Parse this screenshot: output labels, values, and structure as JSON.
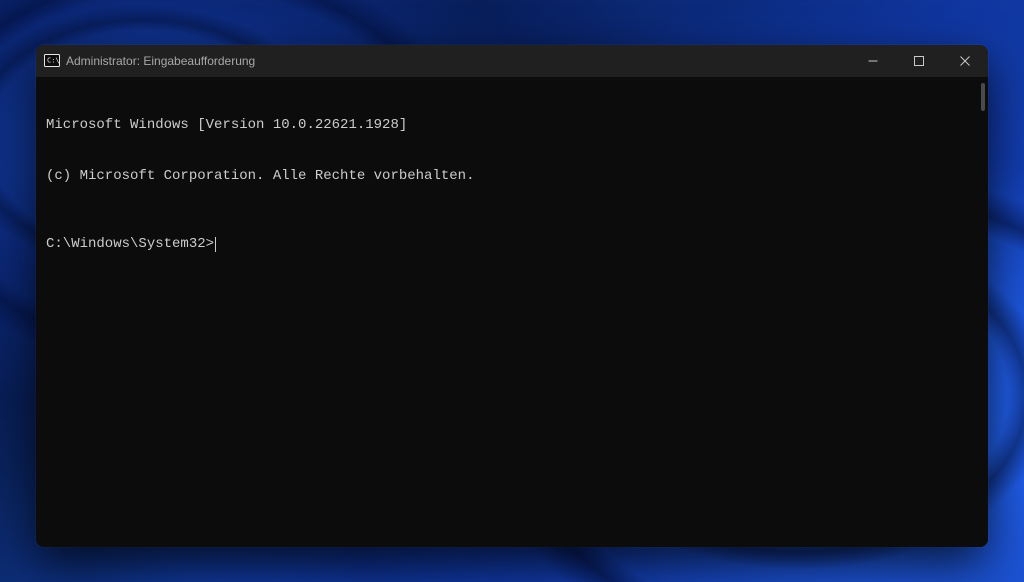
{
  "window": {
    "title": "Administrator: Eingabeaufforderung"
  },
  "terminal": {
    "line1": "Microsoft Windows [Version 10.0.22621.1928]",
    "line2": "(c) Microsoft Corporation. Alle Rechte vorbehalten.",
    "prompt": "C:\\Windows\\System32>"
  }
}
